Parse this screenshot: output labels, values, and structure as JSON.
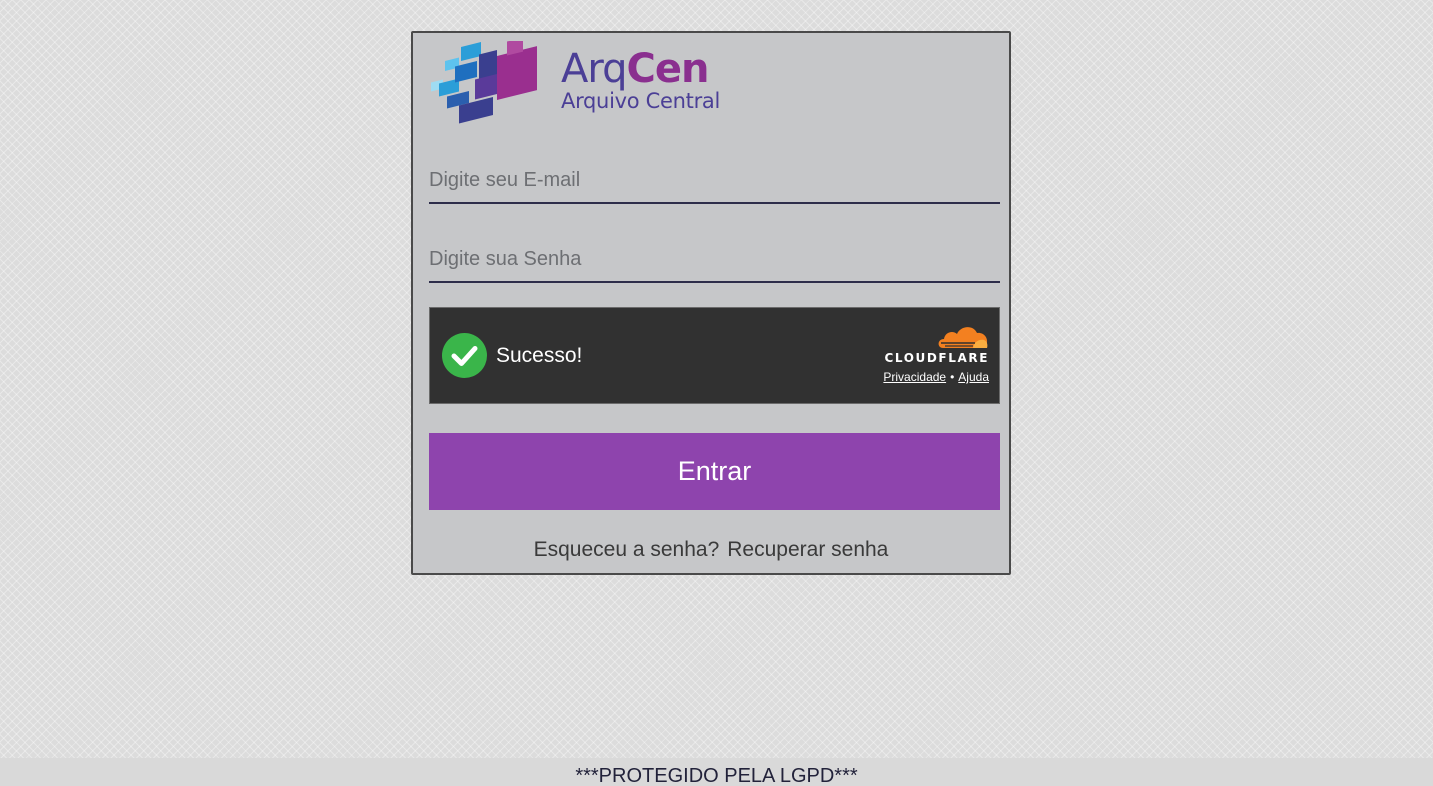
{
  "brand": {
    "name_part1": "Arq",
    "name_part2": "Cen",
    "subtitle": "Arquivo Central"
  },
  "form": {
    "email_placeholder": "Digite seu E-mail",
    "email_value": "",
    "password_placeholder": "Digite sua Senha",
    "password_value": "",
    "submit_label": "Entrar"
  },
  "captcha": {
    "status": "Sucesso!",
    "provider": "CLOUDFLARE",
    "privacy_label": "Privacidade",
    "separator": "•",
    "help_label": "Ajuda"
  },
  "recovery": {
    "question": "Esqueceu a senha?",
    "link_label": "Recuperar senha"
  },
  "footer": {
    "notice": "***PROTEGIDO PELA LGPD***"
  },
  "colors": {
    "accent": "#8e44ad",
    "brand_blue": "#4b3f96",
    "brand_purple": "#8a2f8f",
    "success": "#3ab54a",
    "cloudflare_orange": "#f38020"
  }
}
